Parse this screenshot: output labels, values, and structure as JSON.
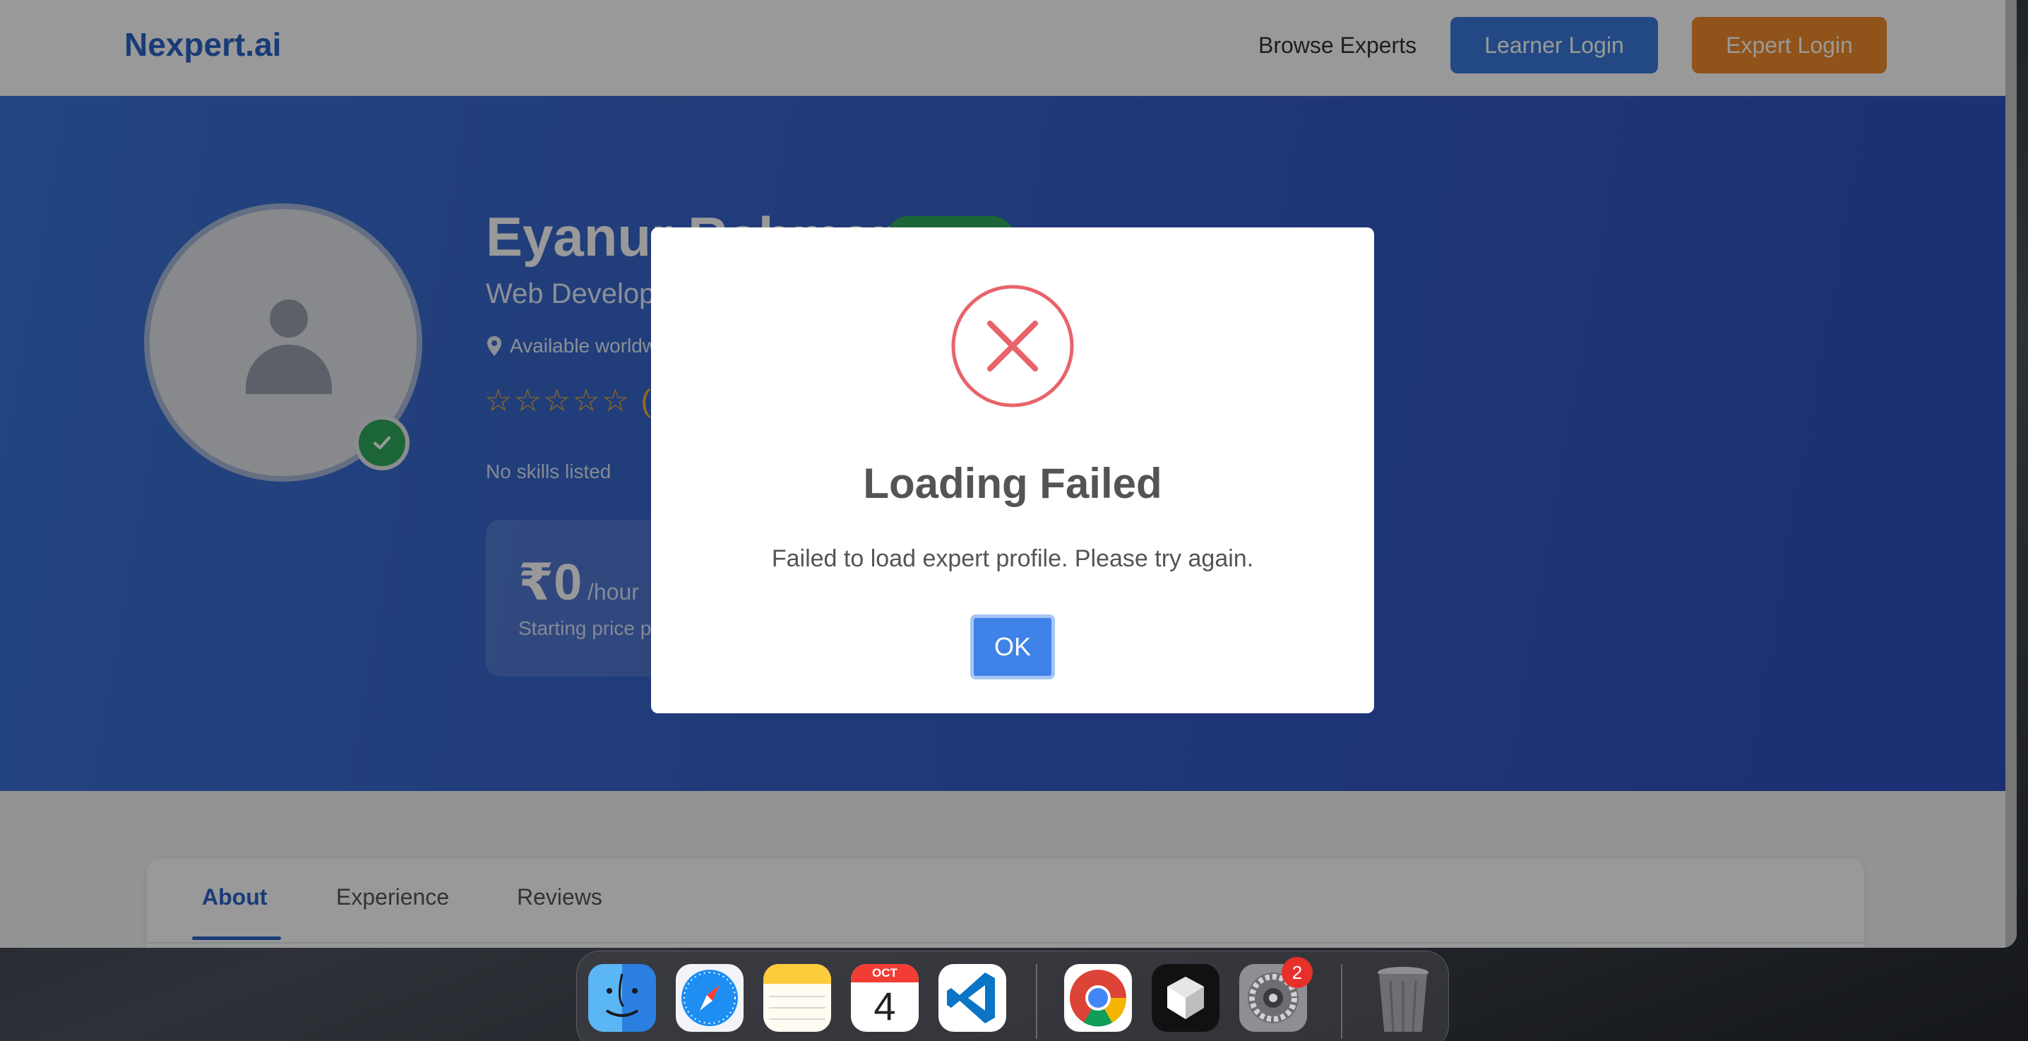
{
  "navbar": {
    "logo": "Nexpert.ai",
    "browse_link": "Browse Experts",
    "learner_login": "Learner Login",
    "expert_login": "Expert Login"
  },
  "profile": {
    "name": "Eyanur Rahman",
    "title": "Web Developer",
    "location": "Available worldwide",
    "stars": "☆☆☆☆☆ (0)",
    "skills": "No skills listed",
    "price": "₹0",
    "price_unit": "/hour",
    "price_note": "Starting price per hour"
  },
  "tabs": [
    "About",
    "Experience",
    "Reviews"
  ],
  "modal": {
    "title": "Loading Failed",
    "message": "Failed to load expert profile. Please try again.",
    "ok_label": "OK"
  },
  "dock": {
    "items": [
      "finder",
      "safari",
      "notes",
      "calendar",
      "vscode",
      "chrome",
      "unity",
      "system-settings",
      "trash"
    ],
    "calendar_month": "OCT",
    "calendar_day": "4",
    "settings_badge": "2"
  },
  "colors": {
    "brand": "#2a64c8",
    "expert_button": "#f08a2a",
    "error": "#e8646a",
    "ok_button": "#3f82e8",
    "verified": "#2fa85a"
  }
}
